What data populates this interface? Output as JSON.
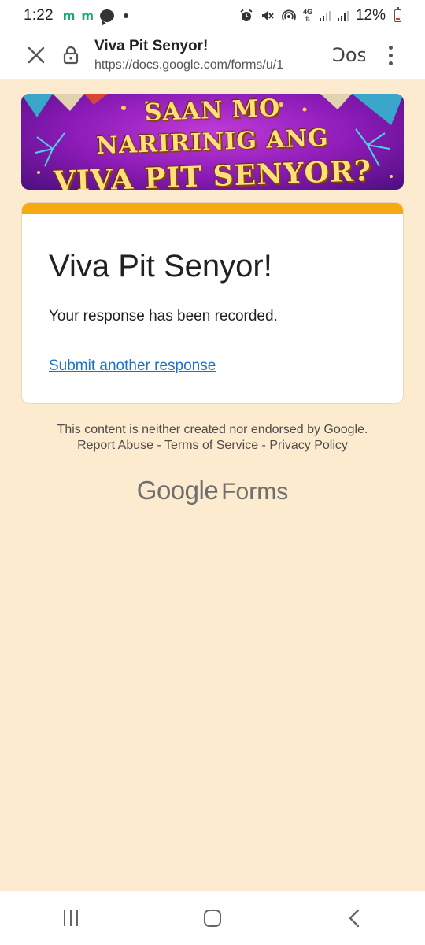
{
  "status_bar": {
    "time": "1:22",
    "notif_m1": "m",
    "notif_m2": "m",
    "network": "4G",
    "battery": "12%"
  },
  "browser": {
    "page_title": "Viva Pit Senyor!",
    "url": "https://docs.google.com/forms/u/1",
    "partial_action": "Ɔos"
  },
  "banner": {
    "line1": "SAAN MO",
    "line2": "NARIRINIG ANG",
    "line3": "VIVA PIT SENYOR?"
  },
  "form": {
    "title": "Viva Pit Senyor!",
    "confirmation": "Your response has been recorded.",
    "submit_another": "Submit another response"
  },
  "footer": {
    "disclaimer": "This content is neither created nor endorsed by Google.",
    "report_abuse": "Report Abuse",
    "sep1": " - ",
    "terms": "Terms of Service",
    "sep2": " - ",
    "privacy": "Privacy Policy",
    "brand_google": "Google",
    "brand_forms": "Forms"
  },
  "colors": {
    "accent": "#f6aa10",
    "page_bg": "#fdebd0",
    "link": "#1a73c8"
  }
}
